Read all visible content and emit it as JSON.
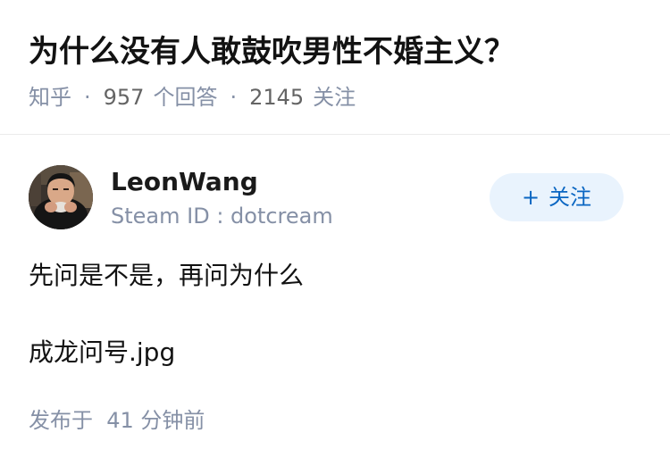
{
  "question": {
    "title": "为什么没有人敢鼓吹男性不婚主义？",
    "source": "知乎",
    "answer_count": "957",
    "answer_count_label": "个回答",
    "follower_count": "2145",
    "follower_count_label": "关注"
  },
  "author": {
    "name": "LeonWang",
    "headline": "Steam ID : dotcream",
    "avatar_icon": "avatar-photo"
  },
  "follow_button": {
    "plus": "+",
    "label": "关注"
  },
  "answer": {
    "paragraphs": [
      "先问是不是，再问为什么",
      "成龙问号.jpg"
    ],
    "publish_prefix": "发布于",
    "publish_time": "41 分钟前"
  },
  "colors": {
    "accent": "#0a66c2",
    "button_bg": "#e9f3fd",
    "meta_text": "#8590a6",
    "title_text": "#121212"
  }
}
